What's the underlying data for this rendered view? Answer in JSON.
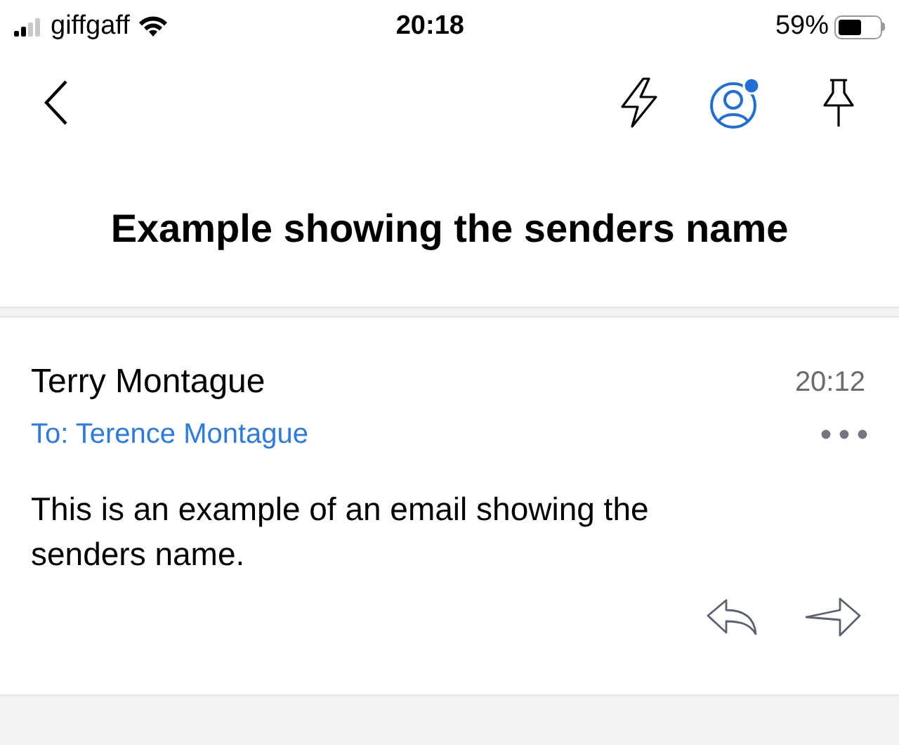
{
  "status_bar": {
    "carrier": "giffgaff",
    "time": "20:18",
    "battery_percent": "59%"
  },
  "nav": {
    "account_notification": true
  },
  "subject": "Example showing the senders name",
  "email": {
    "sender": "Terry Montague",
    "time": "20:12",
    "to": "To: Terence Montague",
    "body": "This is an example of an email showing the senders name."
  }
}
